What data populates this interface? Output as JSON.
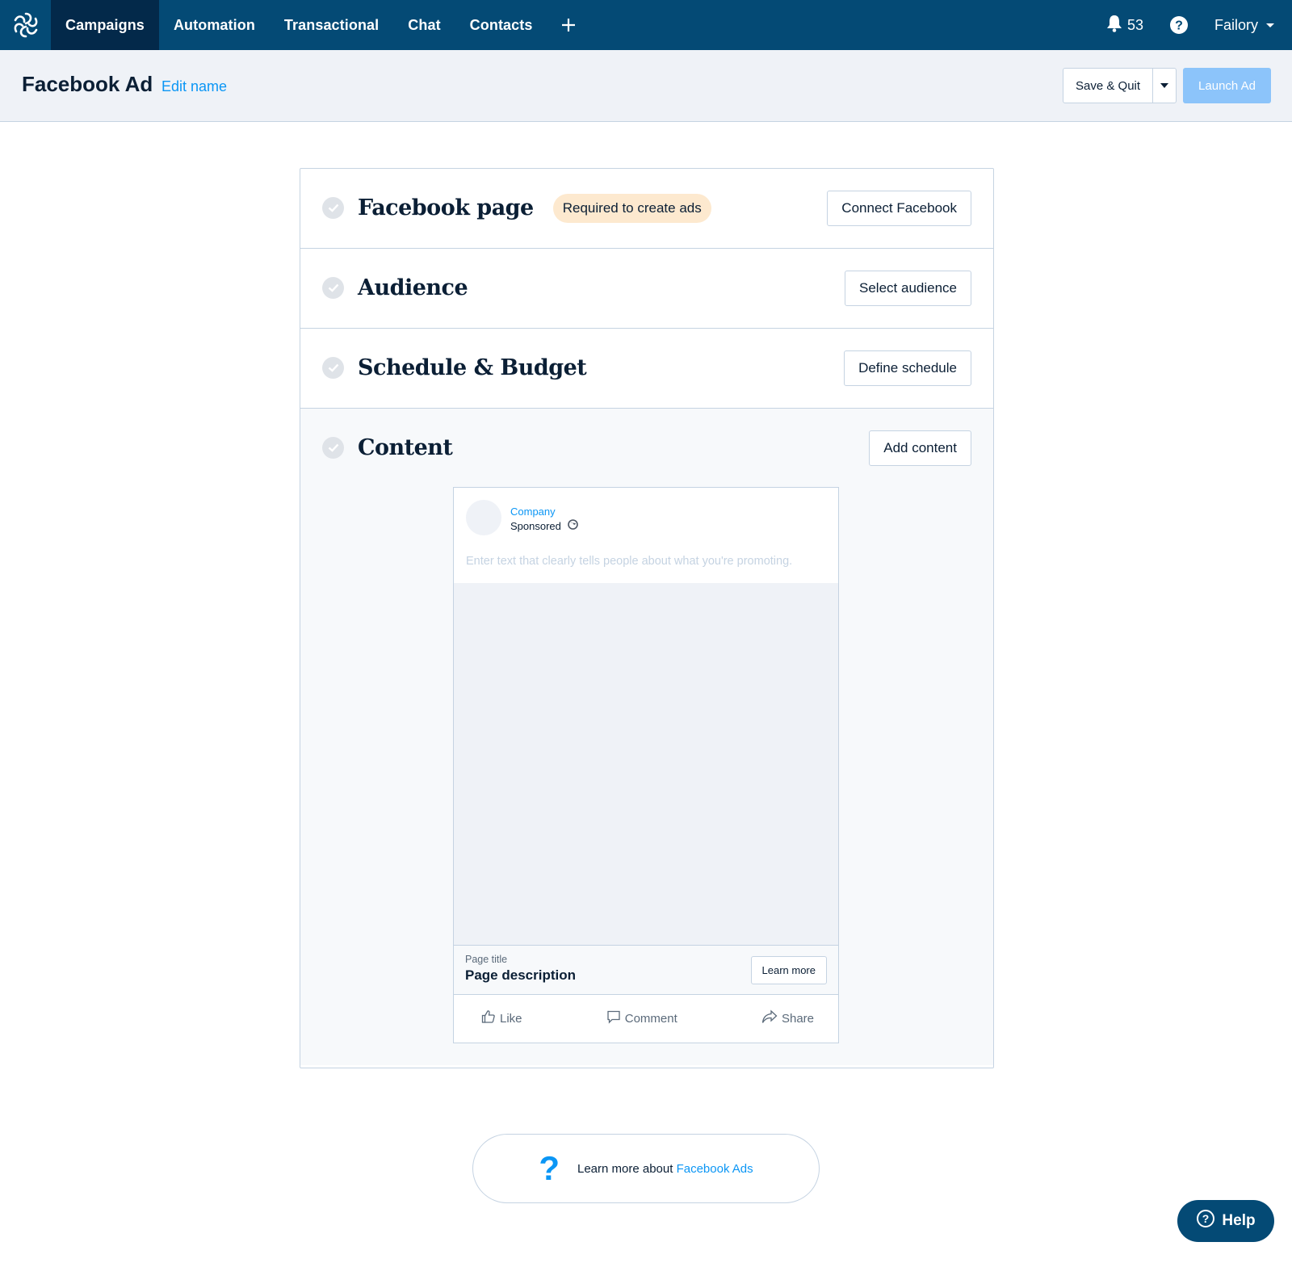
{
  "topnav": {
    "logo_icon": "sendinblue-logo-icon",
    "items": [
      {
        "label": "Campaigns",
        "active": true
      },
      {
        "label": "Automation",
        "active": false
      },
      {
        "label": "Transactional",
        "active": false
      },
      {
        "label": "Chat",
        "active": false
      },
      {
        "label": "Contacts",
        "active": false
      }
    ],
    "add_icon": "plus-icon",
    "notifications_count": "53",
    "account_name": "Failory"
  },
  "header": {
    "title": "Facebook Ad",
    "edit_name_label": "Edit name",
    "save_quit_label": "Save & Quit",
    "launch_label": "Launch Ad"
  },
  "sections": [
    {
      "title": "Facebook page",
      "badge": "Required to create ads",
      "action": "Connect Facebook"
    },
    {
      "title": "Audience",
      "action": "Select audience"
    },
    {
      "title": "Schedule & Budget",
      "action": "Define schedule"
    },
    {
      "title": "Content",
      "action": "Add content"
    }
  ],
  "ad_preview": {
    "company": "Company",
    "sponsored": "Sponsored",
    "text_placeholder": "Enter text that clearly tells people about what you're promoting.",
    "page_title": "Page title",
    "page_description": "Page description",
    "cta_label": "Learn more",
    "actions": [
      "Like",
      "Comment",
      "Share"
    ]
  },
  "learn_more": {
    "prefix": "Learn more about ",
    "link": "Facebook Ads"
  },
  "help_button": {
    "label": "Help"
  },
  "colors": {
    "nav_bg": "#044a75",
    "nav_active": "#03294a",
    "link": "#0b96f5",
    "launch_disabled": "#8cc4fa",
    "badge_bg": "#fde9cf"
  }
}
